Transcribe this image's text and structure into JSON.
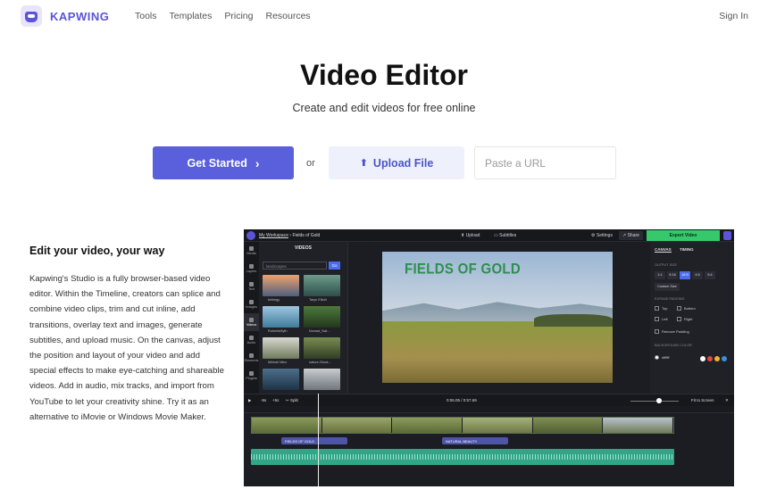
{
  "header": {
    "brand": "KAPWING",
    "nav": [
      "Tools",
      "Templates",
      "Pricing",
      "Resources"
    ],
    "signin": "Sign In"
  },
  "hero": {
    "title": "Video Editor",
    "subtitle": "Create and edit videos for free online",
    "get_started": "Get Started",
    "or": "or",
    "upload": "Upload File",
    "url_placeholder": "Paste a URL"
  },
  "feature": {
    "title": "Edit your video, your way",
    "body": "Kapwing's Studio is a fully browser-based video editor. Within the Timeline, creators can splice and combine video clips, trim and cut inline, add transitions, overlay text and images, generate subtitles, and upload music. On the canvas, adjust the position and layout of your video and add special effects to make eye-catching and shareable videos. Add in audio, mix tracks, and import from YouTube to let your creativity shine. Try it as an alternative to iMovie or Windows Movie Maker."
  },
  "editor": {
    "workspace": "My Workspace",
    "project": "Fields of Gold",
    "upload": "Upload",
    "subtitles": "Subtitles",
    "settings": "Settings",
    "share": "Share",
    "export": "Export Video",
    "tools": [
      "Media",
      "Layers",
      "Text",
      "Images",
      "Videos",
      "Audio",
      "Elements",
      "Plugins"
    ],
    "panel_title": "VIDEOS",
    "search_placeholder": "landscapes",
    "go": "Go",
    "thumbs": [
      "belkegy",
      "Taryn Elliott",
      "RobertsMyth",
      "Nomad_Nat...",
      "Mikhail Nilov",
      "nature-Stock..."
    ],
    "canvas_title": "FIELDS OF GOLD",
    "tabs": [
      "CANVAS",
      "TIMING"
    ],
    "output_size": "OUTPUT SIZE",
    "ratios": [
      "1:1",
      "9:16",
      "16:9",
      "4:5",
      "5:4"
    ],
    "custom_size": "Custom Size",
    "expand_padding": "EXPAND PADDING",
    "padding": [
      "Top",
      "Bottom",
      "Left",
      "Right"
    ],
    "remove_padding": "Remove Padding",
    "bg_color": "BACKGROUND COLOR",
    "bg_value": "#ffffff",
    "transport": [
      "-5s",
      "+5s",
      "Split"
    ],
    "time": "0:06.05 / 0:57.69",
    "fit": "Fit to Screen",
    "text_tracks": [
      "FIELDS OF GOLD",
      "NATURAL BEAUTY"
    ]
  }
}
